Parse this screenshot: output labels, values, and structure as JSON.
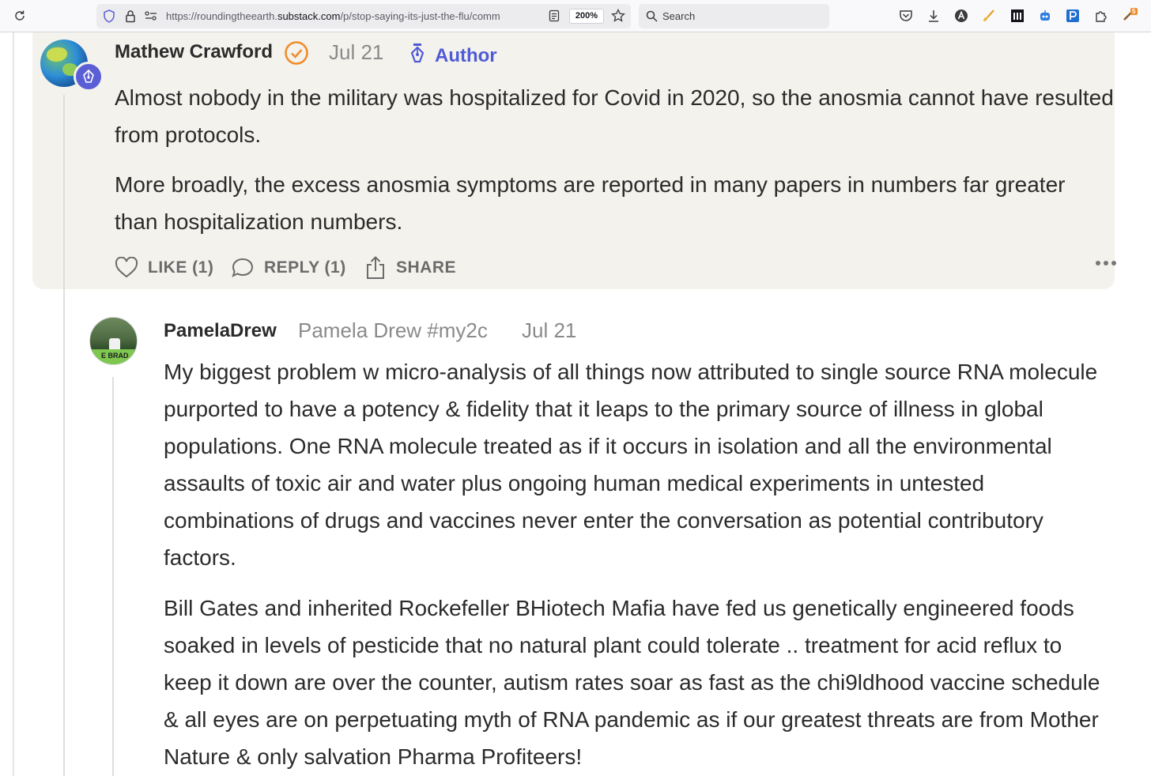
{
  "browser": {
    "url_prefix": "https://",
    "url_domain_pre": "roundingtheearth.",
    "url_domain": "substack.com",
    "url_path": "/p/stop-saying-its-just-the-flu/comm",
    "zoom": "200%",
    "search_placeholder": "Search",
    "extension_badge": "5"
  },
  "comments": [
    {
      "author": "Mathew Crawford",
      "date": "Jul 21",
      "badge_label": "Author",
      "paragraphs": [
        "Almost nobody in the military was hospitalized for Covid in 2020, so the anosmia cannot have resulted from protocols.",
        "More broadly, the excess anosmia symptoms are reported in many papers in numbers far greater than hospitalization numbers."
      ],
      "actions": {
        "like": "LIKE (1)",
        "reply": "REPLY (1)",
        "share": "SHARE"
      }
    },
    {
      "author": "PamelaDrew",
      "display_name": "Pamela Drew #my2c",
      "date": "Jul 21",
      "avatar_text": "E BRAD",
      "paragraphs": [
        "My biggest problem w micro-analysis of all things now attributed to single source RNA molecule purported to have a potency & fidelity that it leaps to the primary source of illness in global populations. One RNA molecule treated as if it occurs in isolation and all the environmental assaults of toxic air and water plus ongoing human medical experiments in untested combinations of drugs and vaccines never enter the conversation as potential contributory factors.",
        "Bill Gates and inherited Rockefeller BHiotech Mafia have fed us genetically engineered foods soaked in levels of pesticide that no natural plant could tolerate .. treatment for acid reflux to keep it down are over the counter, autism rates soar as fast as the chi9ldhood vaccine schedule & all eyes are on perpetuating myth of RNA pandemic as if our greatest threats are from Mother Nature & only salvation Pharma Profiteers!"
      ]
    }
  ],
  "colors": {
    "card_bg": "#f4f2ed",
    "author_accent": "#4f5bd5",
    "verified_orange": "#f08c2b"
  }
}
